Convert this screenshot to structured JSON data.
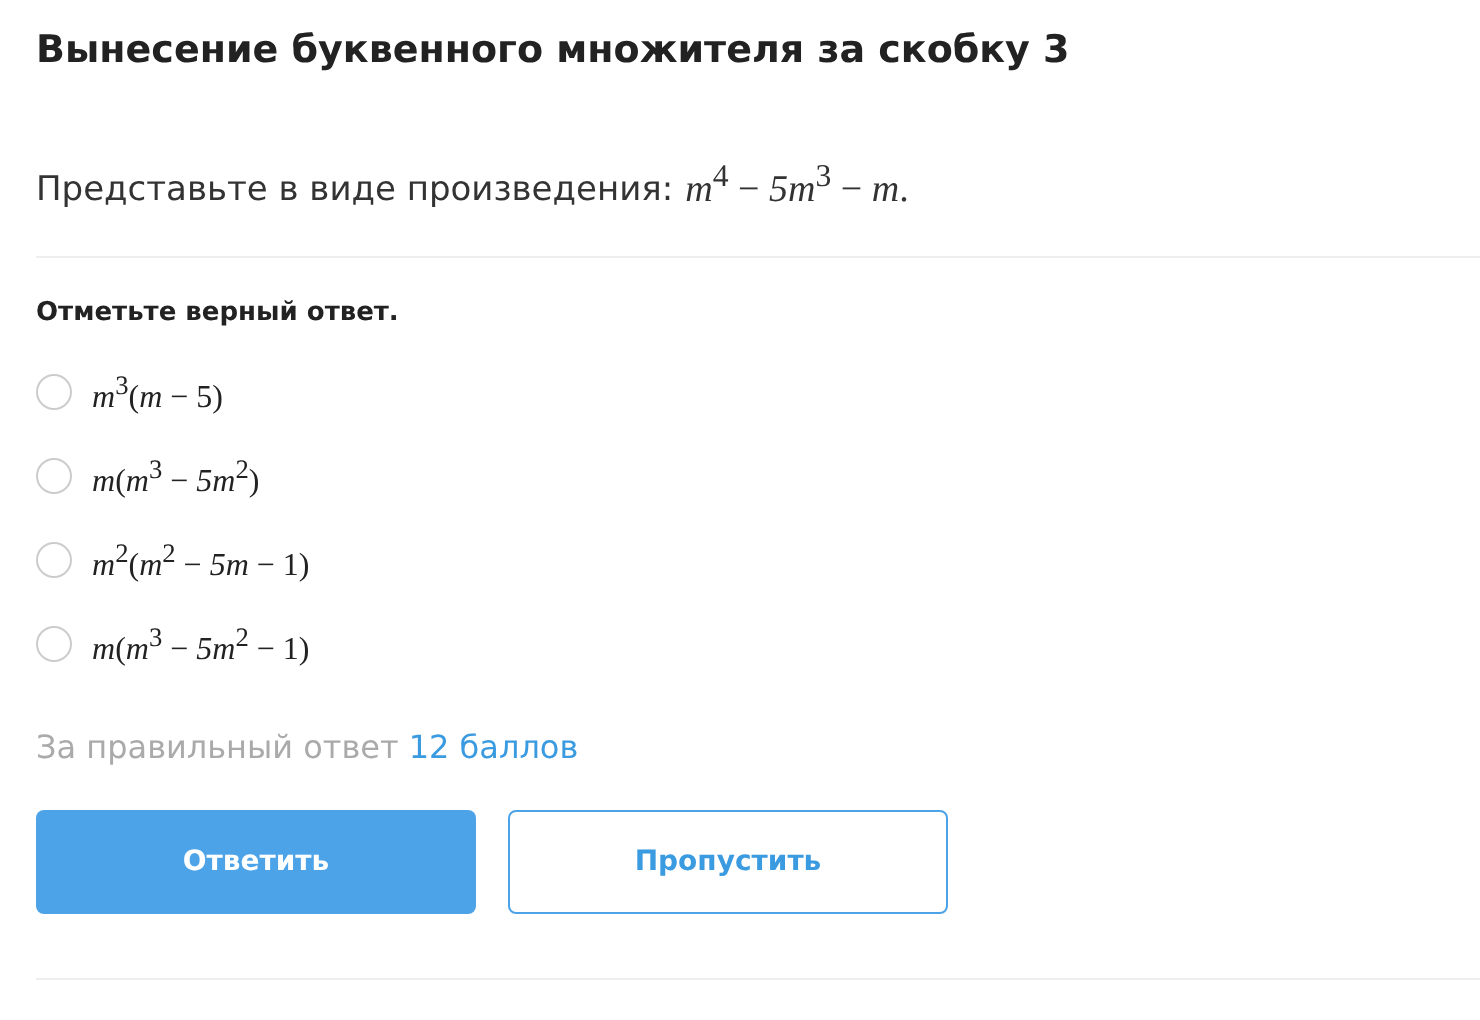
{
  "title": "Вынесение буквенного множителя за скобку 3",
  "question": {
    "prompt": "Представьте в виде произведения:",
    "expression": "*m*$^{4}$ − *5m*$^{3}$ − *m*."
  },
  "instruction": "Отметьте верный ответ.",
  "options": [
    {
      "text": "*m*$^{3}$(*m* − 5)",
      "selected": false
    },
    {
      "text": "*m*(*m*$^{3}$ − *5m*$^{2}$)",
      "selected": false
    },
    {
      "text": "*m*$^{2}$(*m*$^{2}$ − *5m* − 1)",
      "selected": false
    },
    {
      "text": "*m*(*m*$^{3}$ − *5m*$^{2}$ − 1)",
      "selected": false
    }
  ],
  "reward": {
    "text": "За правильный ответ",
    "points": "12 баллов"
  },
  "buttons": [
    {
      "label": "Ответить",
      "kind": "primary"
    },
    {
      "label": "Пропустить",
      "kind": "secondary"
    }
  ]
}
